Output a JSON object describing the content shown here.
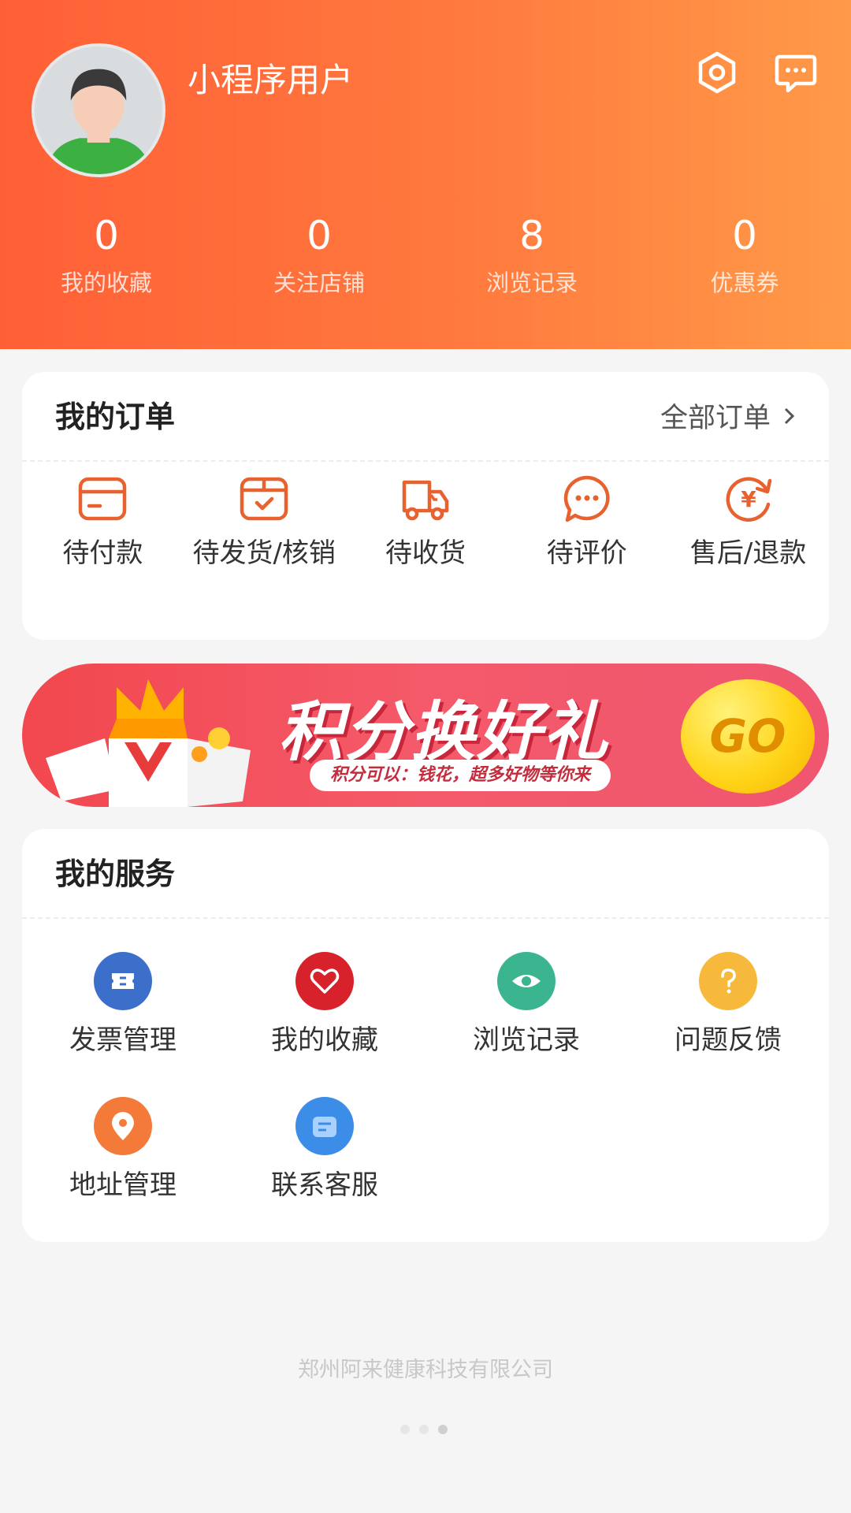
{
  "profile": {
    "username": "小程序用户",
    "settings_icon": "settings-hexagon-icon",
    "message_icon": "message-bubble-icon"
  },
  "stats": [
    {
      "value": "0",
      "label": "我的收藏"
    },
    {
      "value": "0",
      "label": "关注店铺"
    },
    {
      "value": "8",
      "label": "浏览记录"
    },
    {
      "value": "0",
      "label": "优惠券"
    }
  ],
  "orders": {
    "title": "我的订单",
    "all_label": "全部订单",
    "items": [
      {
        "label": "待付款",
        "icon": "wallet-icon"
      },
      {
        "label": "待发货/核销",
        "icon": "box-check-icon"
      },
      {
        "label": "待收货",
        "icon": "truck-icon"
      },
      {
        "label": "待评价",
        "icon": "comment-icon"
      },
      {
        "label": "售后/退款",
        "icon": "refund-yen-icon"
      }
    ]
  },
  "banner": {
    "title": "积分换好礼",
    "subtitle": "积分可以：钱花，超多好物等你来",
    "go_label": "GO"
  },
  "services": {
    "title": "我的服务",
    "items": [
      {
        "label": "发票管理",
        "icon": "invoice-icon",
        "color": "#3b6fc9"
      },
      {
        "label": "我的收藏",
        "icon": "heart-icon",
        "color": "#d8222b"
      },
      {
        "label": "浏览记录",
        "icon": "eye-icon",
        "color": "#3ab58f"
      },
      {
        "label": "问题反馈",
        "icon": "question-icon",
        "color": "#f6b93b"
      },
      {
        "label": "地址管理",
        "icon": "location-pin-icon",
        "color": "#f47a3a"
      },
      {
        "label": "联系客服",
        "icon": "customer-service-icon",
        "color": "#3b8de8"
      }
    ]
  },
  "footer": {
    "company": "郑州阿来健康科技有限公司"
  }
}
